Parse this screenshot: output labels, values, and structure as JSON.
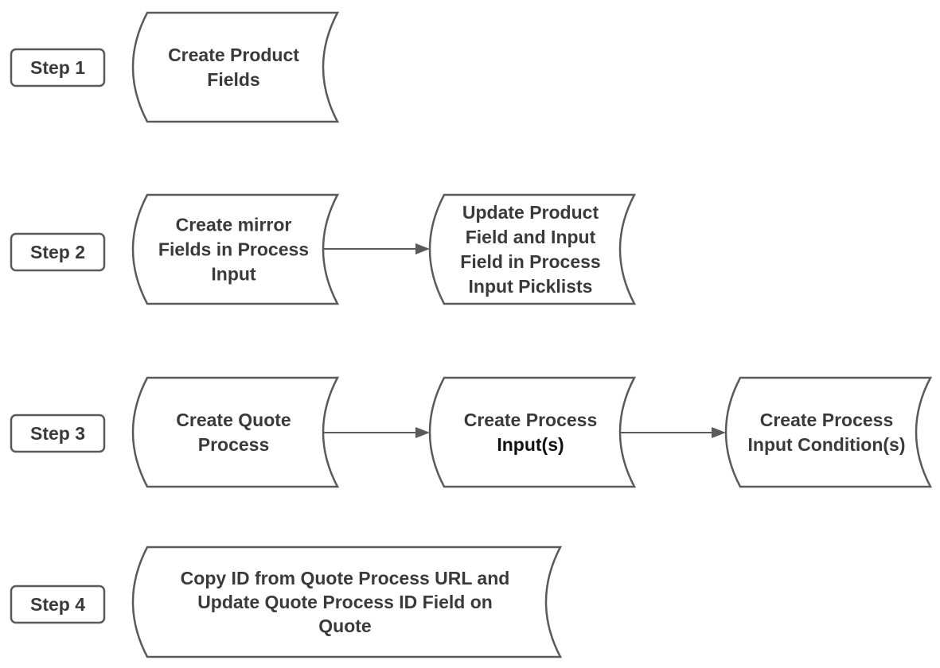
{
  "steps": [
    {
      "label": "Step 1",
      "boxes": [
        [
          "Create Product",
          "Fields"
        ]
      ]
    },
    {
      "label": "Step 2",
      "boxes": [
        [
          "Create mirror",
          "Fields in Process",
          "Input"
        ],
        [
          "Update Product",
          "Field and Input",
          "Field in Process",
          "Input Picklists"
        ]
      ]
    },
    {
      "label": "Step 3",
      "boxes": [
        [
          "Create Quote",
          "Process"
        ],
        [
          "Create Process",
          "Input(s)"
        ],
        [
          "Create Process",
          "Input Condition(s)"
        ]
      ]
    },
    {
      "label": "Step 4",
      "boxes": [
        [
          "Copy ID from Quote Process URL and",
          "Update Quote Process ID Field on",
          "Quote"
        ]
      ]
    }
  ],
  "colors": {
    "stroke": "#5a5a5a",
    "text": "#3a3a3a"
  }
}
